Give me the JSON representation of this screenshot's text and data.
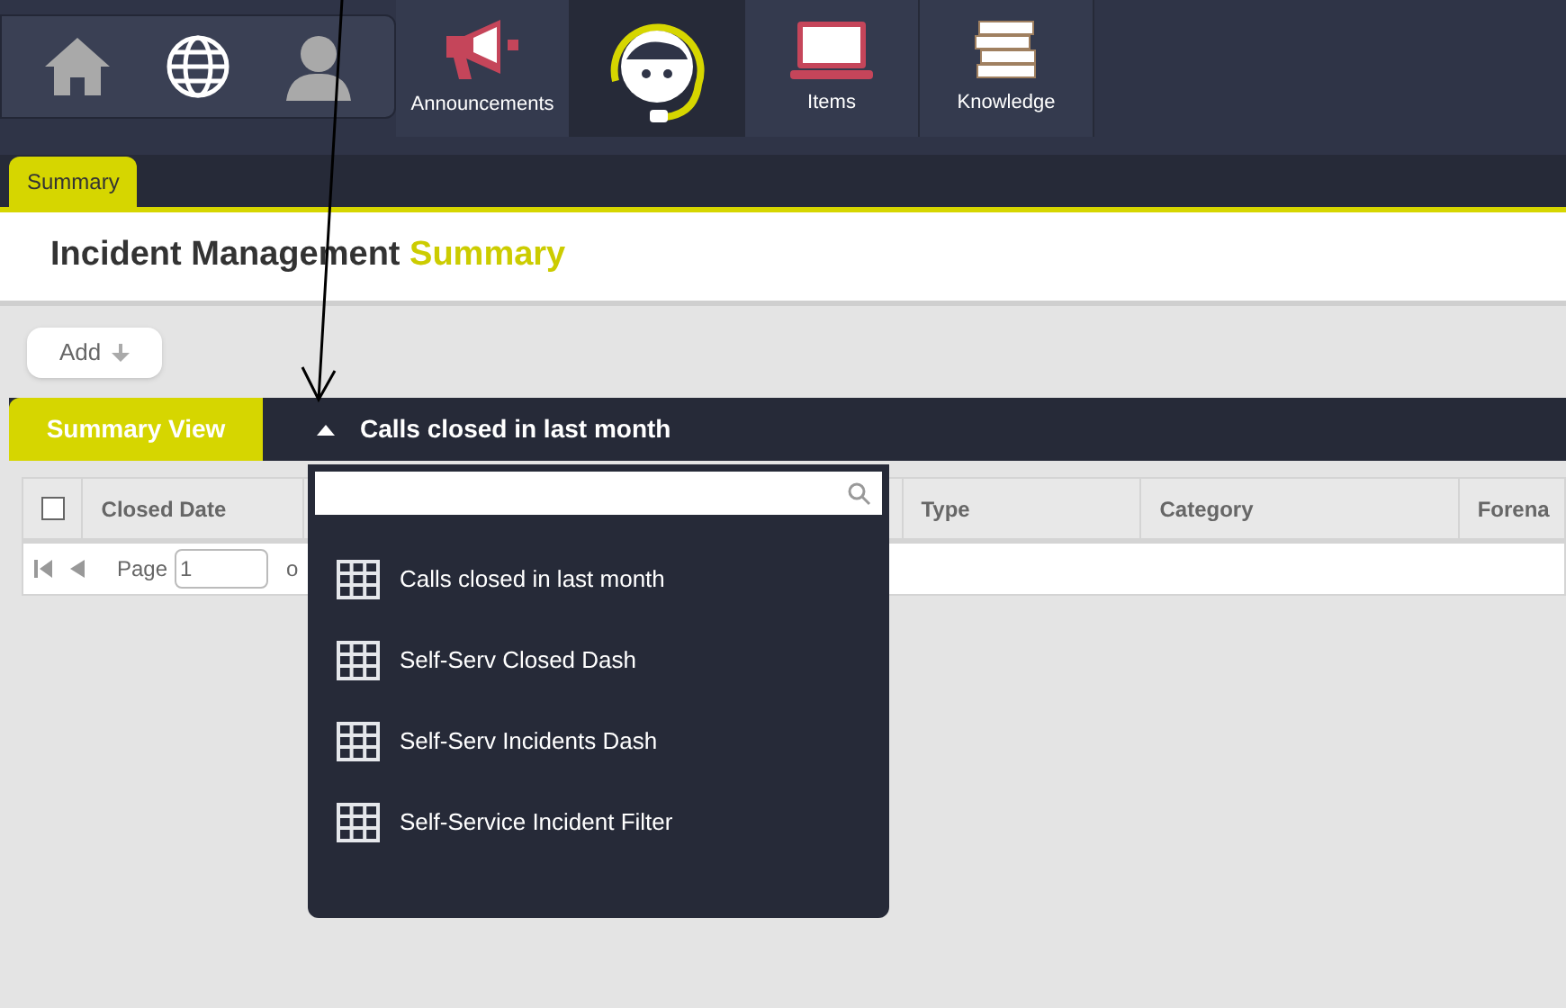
{
  "nav": {
    "tabs": [
      {
        "kind": "announcements",
        "label": "Announcements",
        "selected": false
      },
      {
        "kind": "agent",
        "selected": true
      },
      {
        "kind": "items",
        "label": "Items",
        "selected": false
      },
      {
        "kind": "knowledge",
        "label": "Knowledge",
        "selected": false
      }
    ]
  },
  "subtabs": [
    {
      "label": "Summary",
      "selected": true
    }
  ],
  "page_title": {
    "main": "Incident Management",
    "accent": "Summary"
  },
  "toolbar": {
    "add_button": "Add"
  },
  "view_tab": "Summary View",
  "view_selector": {
    "label": "Calls closed in last month",
    "expanded": true
  },
  "table": {
    "columns": [
      "Closed Date",
      "Type",
      "Category",
      "Forena"
    ],
    "select_all_checked": false
  },
  "pager": {
    "label": "Page",
    "value": "1",
    "of": "o"
  },
  "dropdown": {
    "items": [
      "Calls closed in last month",
      "Self-Serv Closed Dash",
      "Self-Serv Incidents Dash",
      "Self-Service Incident Filter"
    ]
  }
}
